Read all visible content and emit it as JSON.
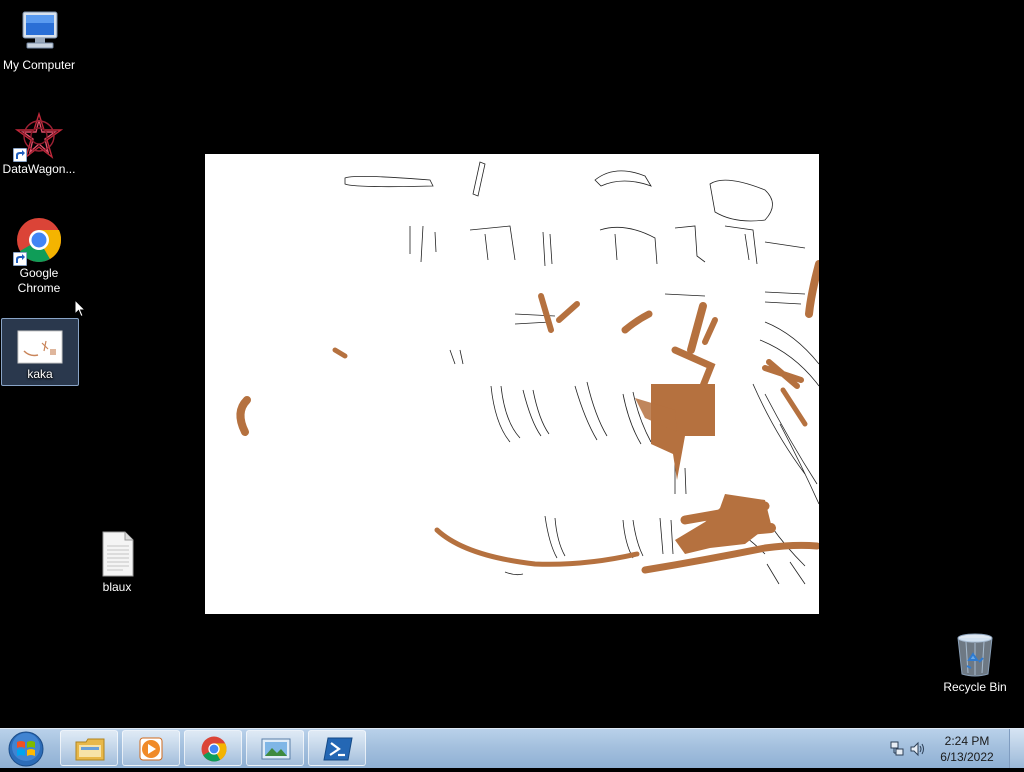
{
  "desktop": {
    "background": "#000000",
    "icons": [
      {
        "label": "My Computer",
        "icon": "computer-icon"
      },
      {
        "label": "DataWagon...",
        "icon": "datawagon-icon"
      },
      {
        "label": "Google Chrome",
        "icon": "chrome-icon"
      },
      {
        "label": "kaka",
        "icon": "image-file-icon"
      },
      {
        "label": "blaux",
        "icon": "text-file-icon"
      },
      {
        "label": "Recycle Bin",
        "icon": "recycle-bin-icon"
      }
    ]
  },
  "taskbar": {
    "pinned": [
      {
        "name": "windows-explorer",
        "icon": "folder-icon"
      },
      {
        "name": "media-player",
        "icon": "media-player-icon"
      },
      {
        "name": "google-chrome",
        "icon": "chrome-icon"
      },
      {
        "name": "image-viewer",
        "icon": "picture-icon"
      },
      {
        "name": "powershell",
        "icon": "powershell-icon"
      }
    ],
    "clock": {
      "time": "2:24 PM",
      "date": "6/13/2022"
    }
  },
  "colors": {
    "sketch_brown": "#b5713f",
    "taskbar": "#a4c0de"
  }
}
